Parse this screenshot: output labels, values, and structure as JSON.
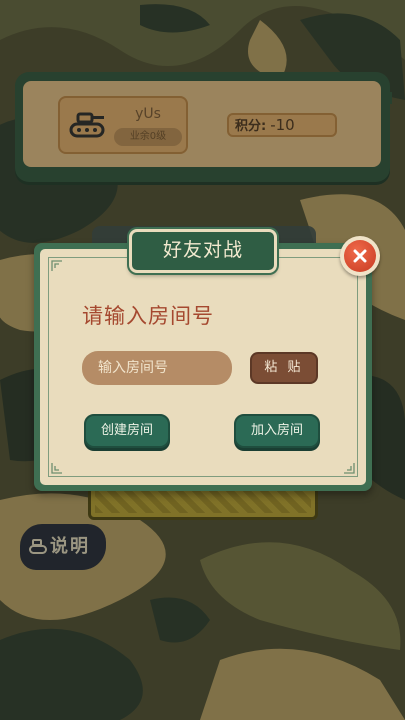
{
  "profile": {
    "username": "yUs",
    "level": "业余0级",
    "score_label": "积分:",
    "score_value": "-10"
  },
  "help_button": {
    "label": "说明"
  },
  "dialog": {
    "title": "好友对战",
    "prompt": "请输入房间号",
    "room_input": {
      "placeholder": "输入房间号",
      "value": ""
    },
    "paste_label": "粘 贴",
    "create_label": "创建房间",
    "join_label": "加入房间"
  },
  "icons": {
    "avatar": "tank-icon",
    "help": "tank-icon",
    "close": "close-x-icon"
  },
  "colors": {
    "dialog_frame": "#3f6f52",
    "dialog_bg": "#e9dcbd",
    "prompt_text": "#a5482f",
    "primary_button": "#2b6a55",
    "paste_button": "#7b4d35",
    "close_button": "#d9472b"
  }
}
